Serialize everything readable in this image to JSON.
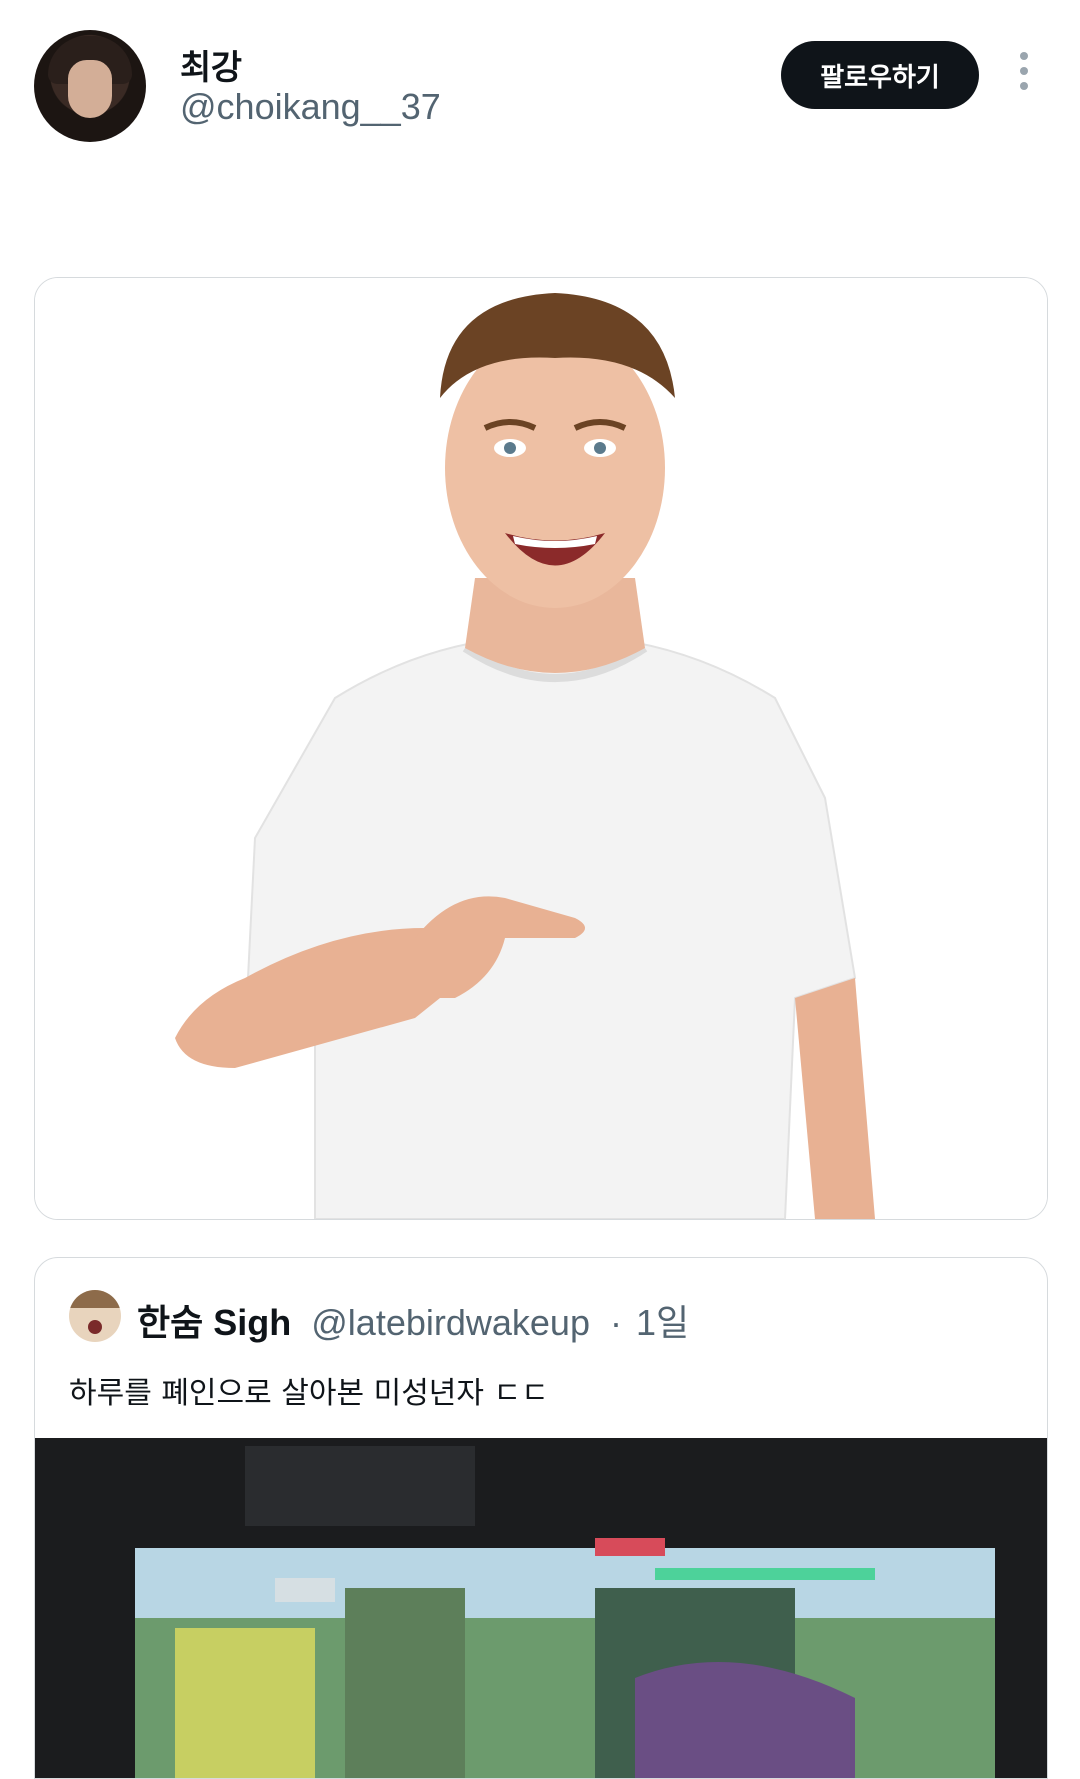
{
  "header": {
    "display_name": "최강",
    "handle": "@choikang__37",
    "follow_label": "팔로우하기"
  },
  "media": {
    "image_icon": "smiling-man-pointing-photo"
  },
  "quote": {
    "display_name": "한숨 Sigh",
    "handle": "@latebirdwakeup",
    "separator": "·",
    "time": "1일",
    "text": "하루를 폐인으로 살아본 미성년자 ㄷㄷ",
    "media_icon": "video-game-screen-photo"
  },
  "colors": {
    "primary_text": "#0f1419",
    "secondary_text": "#536471",
    "button_bg": "#0f1419",
    "border": "#d6dadd"
  }
}
